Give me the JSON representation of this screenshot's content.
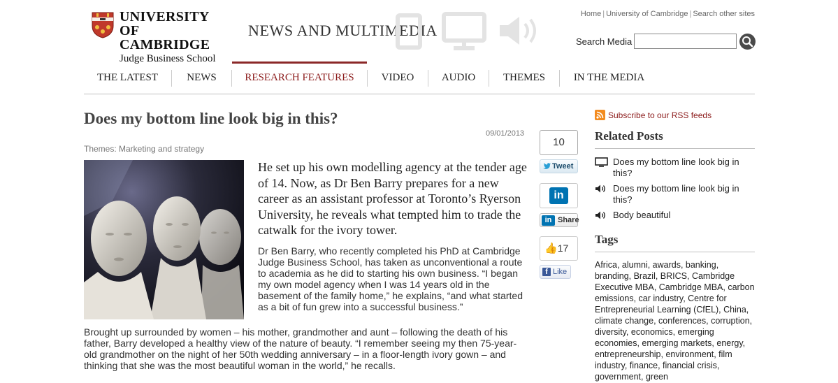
{
  "header": {
    "logo": {
      "line1": "UNIVERSITY OF",
      "line2": "CAMBRIDGE",
      "line3": "Judge Business School"
    },
    "site_title": "NEWS AND MULTIMEDIA",
    "top_links": [
      "Home",
      "University of Cambridge",
      "Search other sites"
    ],
    "search": {
      "label": "Search Media",
      "value": "",
      "placeholder": ""
    }
  },
  "nav": {
    "items": [
      {
        "label": "THE LATEST"
      },
      {
        "label": "NEWS"
      },
      {
        "label": "RESEARCH FEATURES"
      },
      {
        "label": "VIDEO"
      },
      {
        "label": "AUDIO"
      },
      {
        "label": "THEMES"
      },
      {
        "label": "IN THE MEDIA"
      }
    ],
    "active": "RESEARCH FEATURES"
  },
  "article": {
    "title": "Does my bottom line look big in this?",
    "date": "09/01/2013",
    "themes": "Themes: Marketing and strategy",
    "lead": "He set up his own modelling agency at the tender age of 14. Now, as Dr Ben Barry prepares for a new career as an assistant professor at Toronto’s Ryerson University, he reveals what tempted him to trade the catwalk for the ivory tower.",
    "body1": "Dr Ben Barry, who recently completed his PhD at Cambridge Judge Business School, has taken as unconventional a route to academia as he did to starting his own business. “I began my own model agency when I was 14 years old in the basement of the family home,” he explains, “and what started as a bit of fun grew into a successful business.”",
    "body2": "Brought up surrounded by women – his mother, grandmother and aunt – following the death of his father, Barry developed a healthy view of the nature of beauty. “I remember seeing my then 75-year-old grandmother on the night of her 50th wedding anniversary – in a floor-length ivory gown – and thinking that she was the most beautiful woman in the world,” he recalls."
  },
  "share": {
    "tweet_count": "10",
    "tweet_label": "Tweet",
    "linkedin_logo": "in",
    "linkedin_label": "Share",
    "like_count": "17",
    "like_label": "Like",
    "twitter_color": "#2a9fd6",
    "linkedin_color": "#0073b2",
    "facebook_color": "#3b5998"
  },
  "sidebar": {
    "rss_label": "Subscribe to our RSS feeds",
    "related_heading": "Related Posts",
    "related": [
      {
        "icon": "monitor-icon",
        "title": "Does my bottom line look big in this?"
      },
      {
        "icon": "speaker-icon",
        "title": "Does my bottom line look big in this?"
      },
      {
        "icon": "speaker-icon",
        "title": "Body beautiful"
      }
    ],
    "tags_heading": "Tags",
    "tags": "Africa, alumni, awards, banking, branding, Brazil, BRICS, Cambridge Executive MBA, Cambridge MBA, carbon emissions, car industry, Centre for Entrepreneurial Learning (CfEL), China, climate change, conferences, corruption, diversity, economics, emerging economies, emerging markets, energy, entrepreneurship, environment, film industry, finance, financial crisis, government, green"
  },
  "colors": {
    "accent": "#8b1a1a",
    "rss": "#f38b1f"
  }
}
